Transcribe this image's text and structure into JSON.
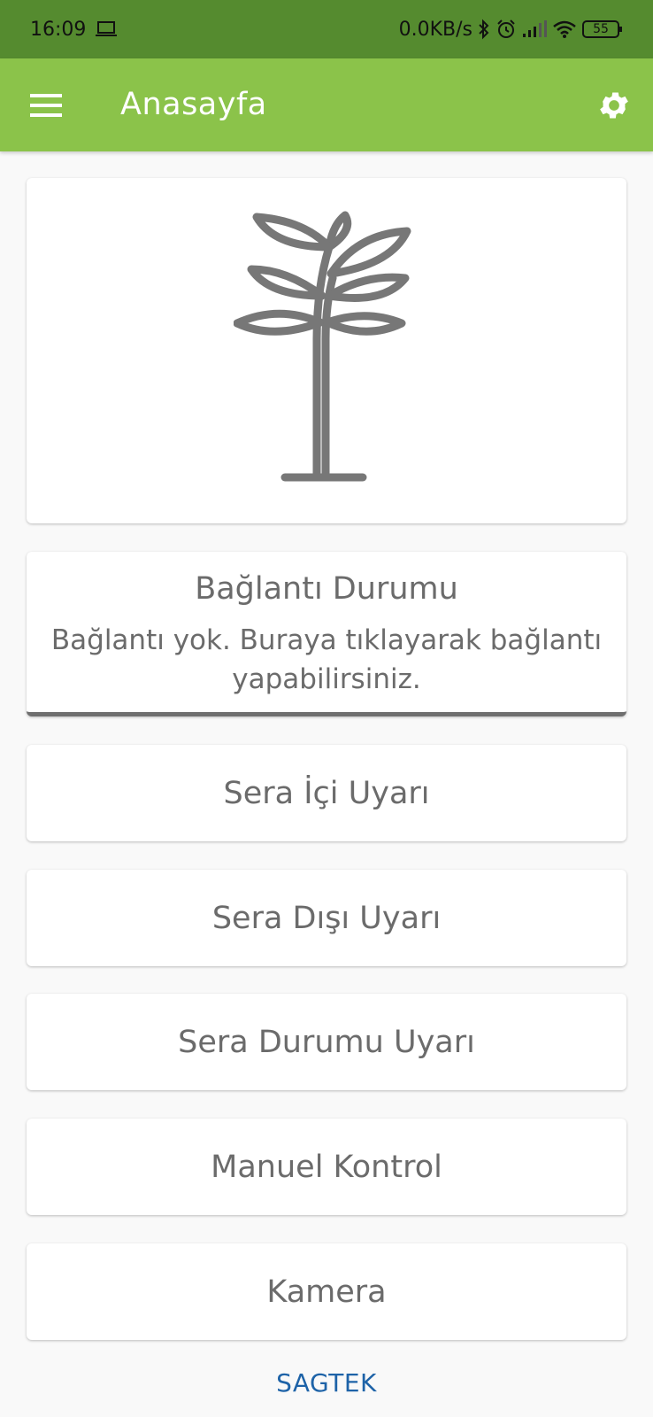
{
  "status_bar": {
    "time": "16:09",
    "network_speed": "0.0KB/s",
    "battery": "55",
    "icons": [
      "laptop-icon",
      "bluetooth-icon",
      "alarm-icon",
      "signal-icon",
      "wifi-icon",
      "battery-icon"
    ]
  },
  "app_bar": {
    "title": "Anasayfa",
    "menu_icon": "hamburger-menu-icon",
    "settings_icon": "gear-icon",
    "color": "#8bc34a"
  },
  "hero": {
    "icon": "plant-tree-icon"
  },
  "connection": {
    "title": "Bağlantı Durumu",
    "description": "Bağlantı yok. Buraya tıklayarak bağlantı yapabilirsiniz."
  },
  "menu": {
    "items": [
      {
        "label": "Sera İçi Uyarı"
      },
      {
        "label": "Sera Dışı Uyarı"
      },
      {
        "label": "Sera Durumu Uyarı"
      },
      {
        "label": "Manuel Kontrol"
      },
      {
        "label": "Kamera"
      }
    ]
  },
  "footer": {
    "brand": "SAGTEK",
    "color": "#1e63a8"
  }
}
